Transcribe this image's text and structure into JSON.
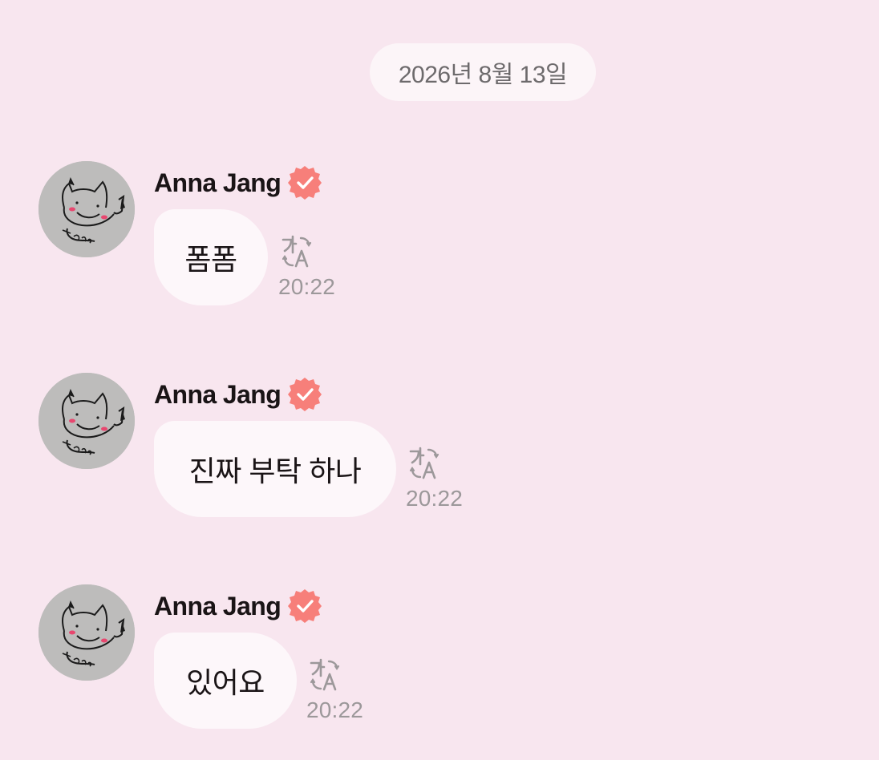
{
  "chat": {
    "date_separator": "2026년 8월 13일",
    "accent_color": "#f77f7a",
    "messages": [
      {
        "sender": "Anna Jang",
        "verified": true,
        "text": "폼폼",
        "time": "20:22",
        "avatar_icon": "cat-doodle-avatar",
        "action_icon": "translate-icon"
      },
      {
        "sender": "Anna Jang",
        "verified": true,
        "text": "진짜 부탁 하나",
        "time": "20:22",
        "avatar_icon": "cat-doodle-avatar",
        "action_icon": "translate-icon"
      },
      {
        "sender": "Anna Jang",
        "verified": true,
        "text": "있어요",
        "time": "20:22",
        "avatar_icon": "cat-doodle-avatar",
        "action_icon": "translate-icon"
      }
    ]
  }
}
